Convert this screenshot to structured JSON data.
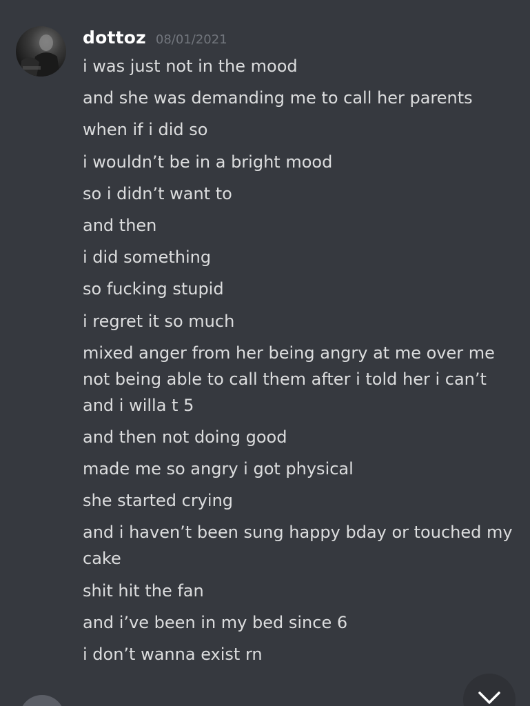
{
  "message": {
    "author": "dottoz",
    "timestamp": "08/01/2021",
    "avatar_icon": "user-avatar",
    "lines": [
      "i was just not in the mood",
      "and she was demanding me to call her parents",
      "when if i did so",
      "i wouldn’t be in a bright mood",
      "so i didn’t want to",
      "and then",
      "i did something",
      "so fucking stupid",
      "i regret it so much",
      "mixed anger from her being angry at me over me not being able to call them after i told her i can’t and i willa t 5",
      "and then not doing good",
      "made me so angry i got physical",
      "she started crying",
      "and i haven’t been sung happy bday or touched my cake",
      "shit hit the fan",
      "and i’ve been in my bed since 6",
      "i don’t wanna exist rn"
    ]
  },
  "jump_button": {
    "icon": "chevron-down-icon"
  },
  "colors": {
    "background": "#36393f",
    "username": "#ffffff",
    "timestamp": "#72767d",
    "message_text": "#dcddde",
    "jump_button": "#2f3136"
  }
}
